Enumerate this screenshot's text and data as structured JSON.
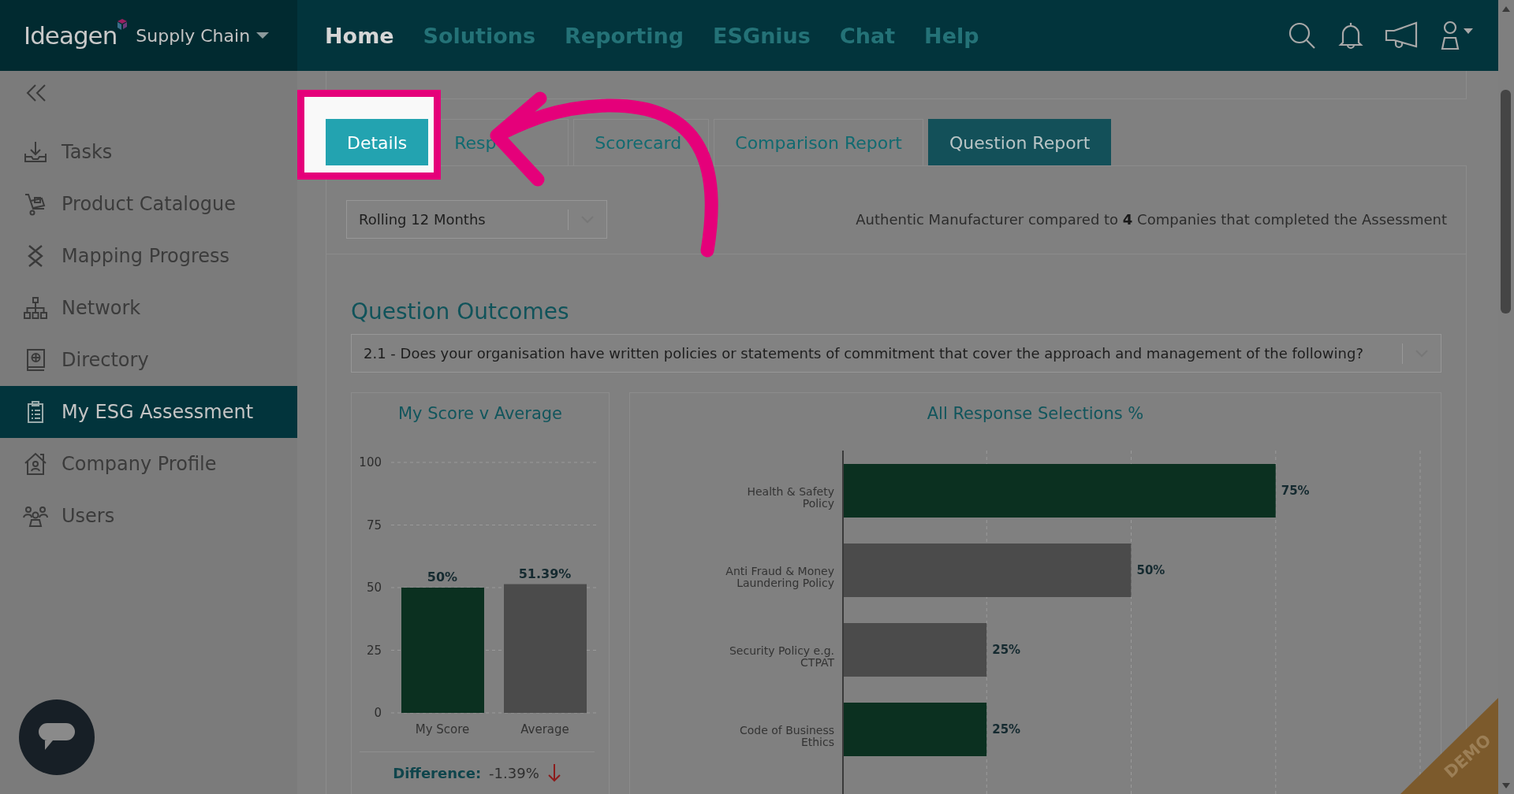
{
  "brand": {
    "logo": "Ideagen",
    "product": "Supply Chain"
  },
  "nav": [
    {
      "label": "Home",
      "selected": true
    },
    {
      "label": "Solutions",
      "selected": false
    },
    {
      "label": "Reporting",
      "selected": false
    },
    {
      "label": "ESGnius",
      "selected": false
    },
    {
      "label": "Chat",
      "selected": false
    },
    {
      "label": "Help",
      "selected": false
    }
  ],
  "sidebar": {
    "items": [
      {
        "label": "Tasks",
        "selected": false
      },
      {
        "label": "Product Catalogue",
        "selected": false
      },
      {
        "label": "Mapping Progress",
        "selected": false
      },
      {
        "label": "Network",
        "selected": false
      },
      {
        "label": "Directory",
        "selected": false
      },
      {
        "label": "My ESG Assessment",
        "selected": true
      },
      {
        "label": "Company Profile",
        "selected": false
      },
      {
        "label": "Users",
        "selected": false
      }
    ]
  },
  "tabs": [
    {
      "label": "Details",
      "selected": false,
      "highlighted": true
    },
    {
      "label": "Resp",
      "selected": false,
      "highlighted": false
    },
    {
      "label": "Scorecard",
      "selected": false,
      "highlighted": false
    },
    {
      "label": "Comparison Report",
      "selected": false,
      "highlighted": false
    },
    {
      "label": "Question Report",
      "selected": true,
      "highlighted": false
    }
  ],
  "period_select": {
    "value": "Rolling 12 Months"
  },
  "comparison_note": "Authentic Manufacturer compared to **4** Companies that completed the Assessment",
  "section_title": "Question Outcomes",
  "question_select": {
    "value": "2.1 - Does your organisation have written policies or statements of commitment that cover the approach and management of the following?"
  },
  "score_chart": {
    "title": "My Score v Average",
    "bars": [
      {
        "color": "#0b3020"
      },
      {
        "color": "#4b4b4b"
      }
    ],
    "chart_data": {
      "type": "bar",
      "categories": [
        "My Score",
        "Average"
      ],
      "values": [
        50,
        51.39
      ],
      "value_labels": [
        "50%",
        "51.39%"
      ],
      "ylim": [
        0,
        100
      ],
      "yticks": [
        0,
        25,
        50,
        75,
        100
      ],
      "grid": true
    },
    "difference": {
      "label": "Difference:",
      "value": "-1.39%"
    }
  },
  "responses_chart": {
    "title": "All Response Selections %",
    "bars": [
      {
        "color": "#0b3020"
      },
      {
        "color": "#4b4b4b"
      },
      {
        "color": "#4b4b4b"
      },
      {
        "color": "#0b3020"
      }
    ],
    "chart_data": {
      "type": "bar",
      "orientation": "horizontal",
      "categories": [
        "Health & Safety Policy",
        "Anti Fraud & Money Laundering Policy",
        "Security Policy e.g. CTPAT",
        "Code of Business Ethics"
      ],
      "values": [
        75,
        50,
        25,
        25
      ],
      "value_labels": [
        "75%",
        "50%",
        "25%",
        "25%"
      ],
      "xlim": [
        0,
        100
      ],
      "grid": true
    }
  },
  "ribbon": {
    "label": "DEMO"
  }
}
